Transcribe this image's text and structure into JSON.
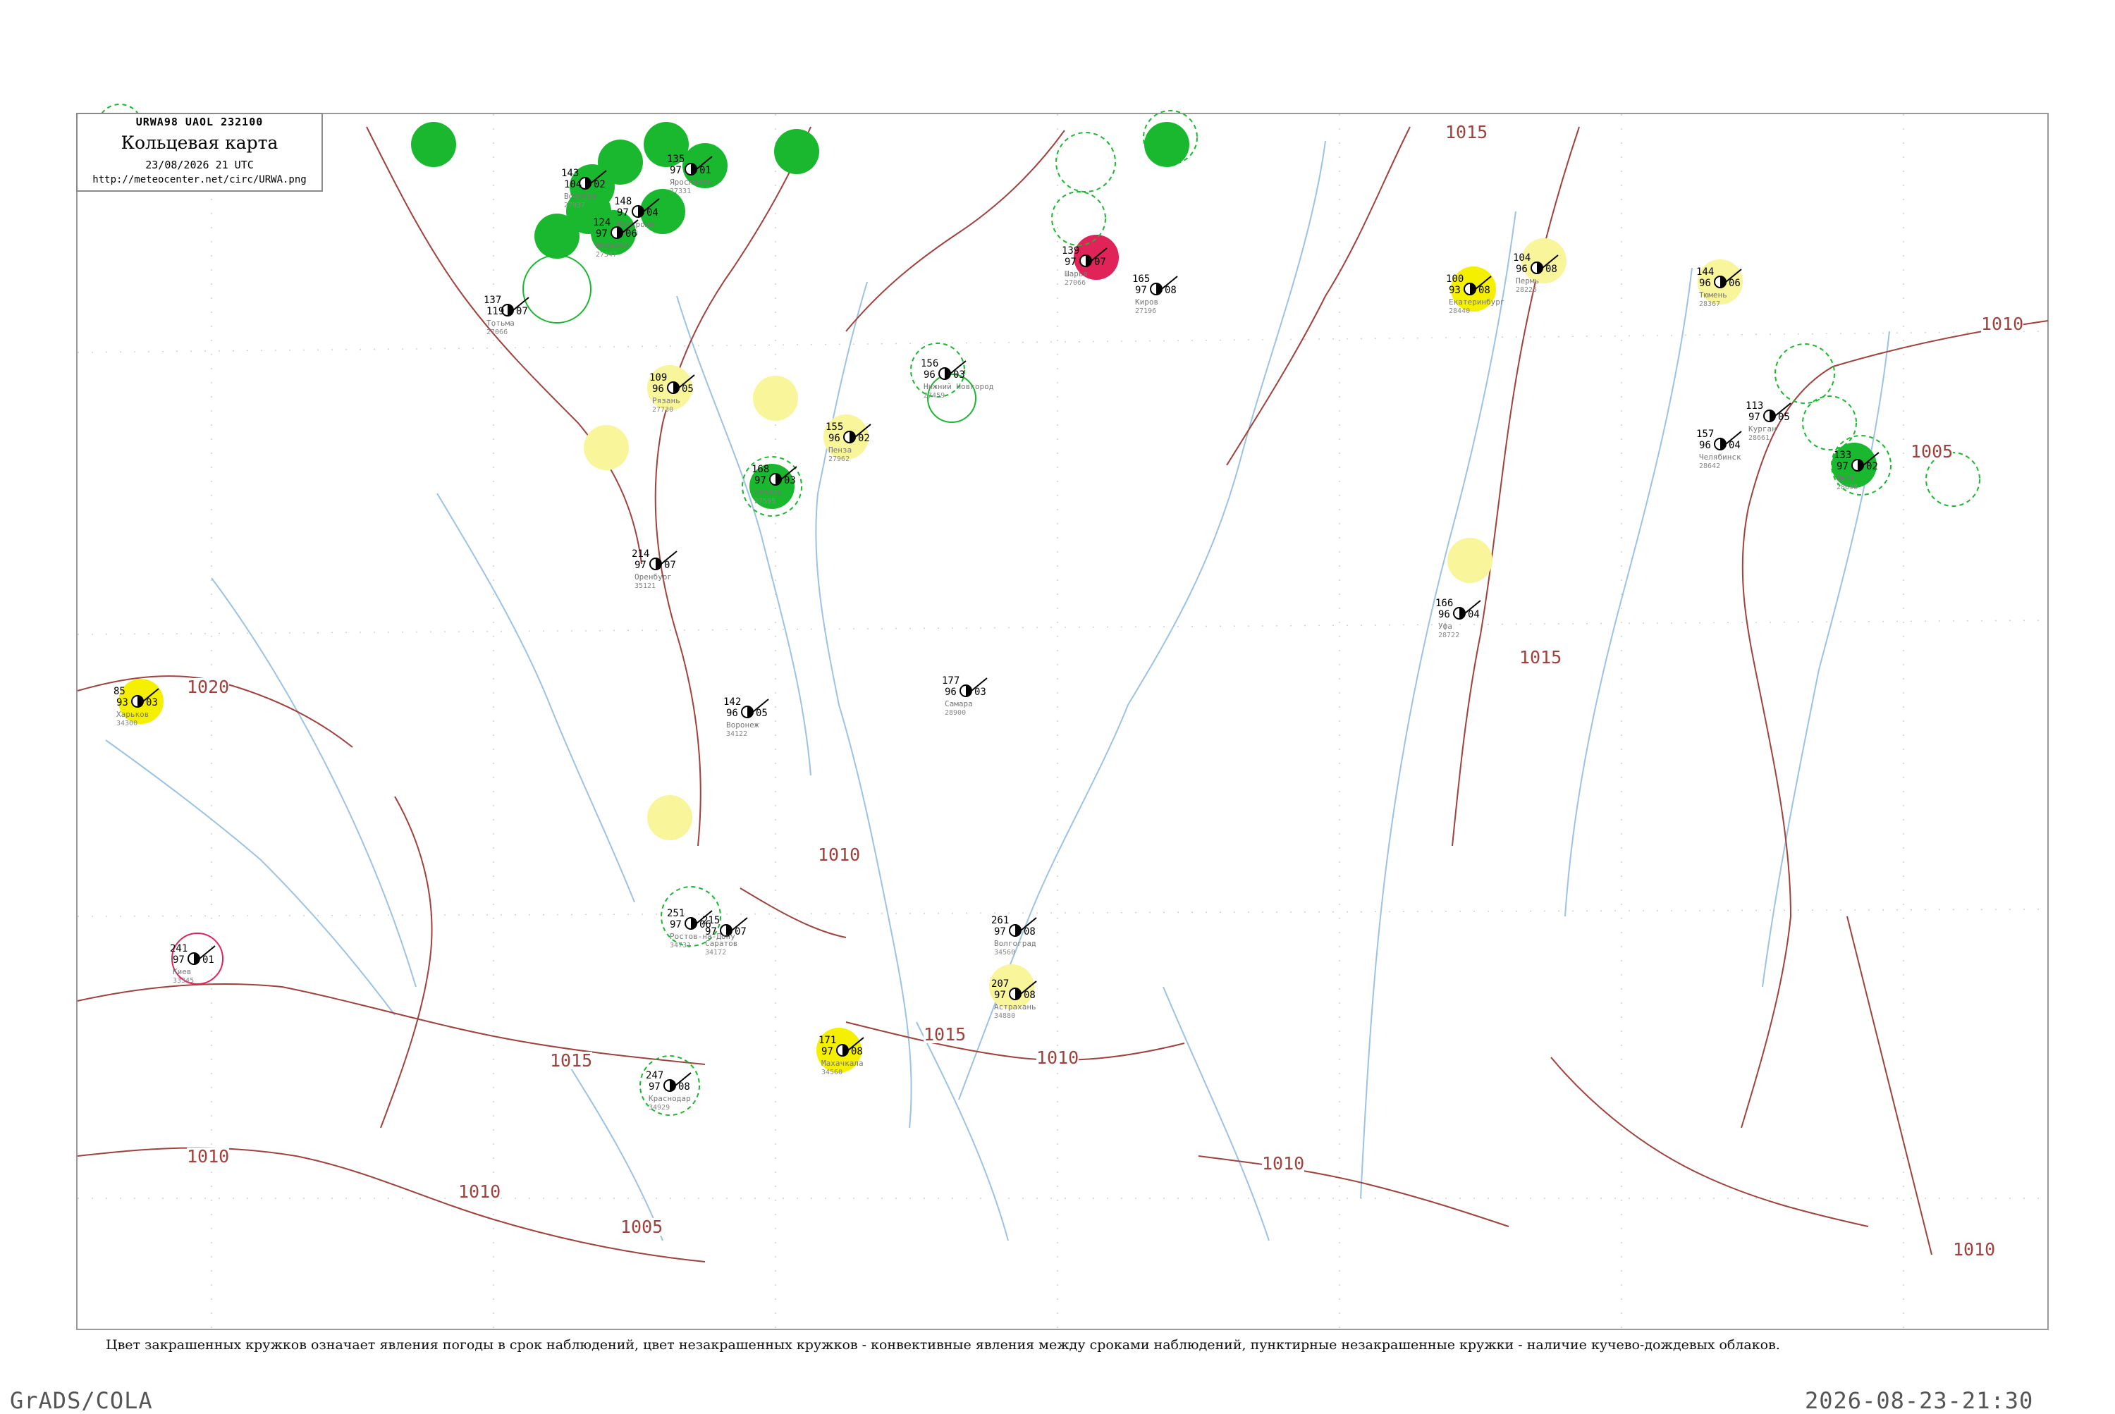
{
  "header": {
    "product_code": "URWA98  UAOL  232100",
    "title": "Кольцевая карта",
    "datetime": "23/08/2026 21 UTC",
    "url": "http://meteocenter.net/circ/URWA.png"
  },
  "caption": "Цвет закрашенных кружков означает явления погоды в срок наблюдений, цвет незакрашенных кружков - конвективные явления между сроками наблюдений, пунктирные незакрашенные кружки - наличие кучево-дождевых облаков.",
  "footer": {
    "software": "GrADS/COLA",
    "timestamp": "2026-08-23-21:30"
  },
  "colors": {
    "isobar": "#a0413c",
    "river": "#9cc2e6",
    "gridline": "#bfbfbf",
    "station": "#000000",
    "thunderstorm": "#19b82e",
    "precip_yellow": "#f5f000",
    "precip_light": "#f8f59a",
    "fog_red": "#e0245a",
    "cb_dashed": "#19b82e"
  },
  "isobars": [
    {
      "label": "1010",
      "value": 1010
    },
    {
      "label": "1015",
      "value": 1015
    },
    {
      "label": "1020",
      "value": 1020
    },
    {
      "label": "1005",
      "value": 1005
    }
  ],
  "iso_labels": [
    {
      "label": "1015",
      "pos": "top-center"
    },
    {
      "label": "1010",
      "pos": "right-upper"
    },
    {
      "label": "1005",
      "pos": "right-middle"
    },
    {
      "label": "1020",
      "pos": "left-middle"
    },
    {
      "label": "1010",
      "pos": "center"
    },
    {
      "label": "1015",
      "pos": "right-center"
    },
    {
      "label": "1015",
      "pos": "center-south"
    },
    {
      "label": "1010",
      "pos": "center-south"
    },
    {
      "label": "1015",
      "pos": "left-south"
    },
    {
      "label": "1010",
      "pos": "left-south"
    },
    {
      "label": "1010",
      "pos": "south"
    },
    {
      "label": "1005",
      "pos": "south"
    },
    {
      "label": "1010",
      "pos": "south-right"
    },
    {
      "label": "1010",
      "pos": "far-right-south"
    }
  ],
  "stations": [
    {
      "name": "Тотьма",
      "id": "27066",
      "t": "137",
      "p": "119",
      "dp": "07",
      "color": "none"
    },
    {
      "name": "Вологда",
      "id": "27037",
      "t": "143",
      "p": "104",
      "dp": "02",
      "color": "none"
    },
    {
      "name": "Кострома",
      "id": "27333",
      "t": "148",
      "p": "97",
      "dp": "04",
      "color": "thunderstorm"
    },
    {
      "name": "Иваново",
      "id": "27347",
      "t": "124",
      "p": "97",
      "dp": "06",
      "color": "thunderstorm"
    },
    {
      "name": "Ярославль",
      "id": "27331",
      "t": "135",
      "p": "97",
      "dp": "01",
      "color": "thunderstorm"
    },
    {
      "name": "Шарья",
      "id": "27066",
      "t": "139",
      "p": "97",
      "dp": "07",
      "color": "fog"
    },
    {
      "name": "Киров",
      "id": "27196",
      "t": "165",
      "p": "97",
      "dp": "08",
      "color": "none"
    },
    {
      "name": "Пермь",
      "id": "28225",
      "t": "104",
      "p": "96",
      "dp": "08",
      "color": "precip_light"
    },
    {
      "name": "Екатеринбург",
      "id": "28440",
      "t": "100",
      "p": "93",
      "dp": "08",
      "color": "precip_yellow"
    },
    {
      "name": "Тюмень",
      "id": "28367",
      "t": "144",
      "p": "96",
      "dp": "06",
      "color": "precip_light"
    },
    {
      "name": "Рязань",
      "id": "27730",
      "t": "109",
      "p": "96",
      "dp": "05",
      "color": "precip_light"
    },
    {
      "name": "Пенза",
      "id": "27962",
      "t": "155",
      "p": "96",
      "dp": "02",
      "color": "precip_light"
    },
    {
      "name": "Нижний Новгород",
      "id": "27459",
      "t": "156",
      "p": "96",
      "dp": "03",
      "color": "none"
    },
    {
      "name": "Казань",
      "id": "27595",
      "t": "168",
      "p": "97",
      "dp": "03",
      "color": "none"
    },
    {
      "name": "Самара",
      "id": "28900",
      "t": "177",
      "p": "96",
      "dp": "03",
      "color": "none"
    },
    {
      "name": "Оренбург",
      "id": "35121",
      "t": "214",
      "p": "97",
      "dp": "07",
      "color": "none"
    },
    {
      "name": "Уфа",
      "id": "28722",
      "t": "166",
      "p": "96",
      "dp": "04",
      "color": "none"
    },
    {
      "name": "Челябинск",
      "id": "28642",
      "t": "157",
      "p": "96",
      "dp": "04",
      "color": "none"
    },
    {
      "name": "Курган",
      "id": "28661",
      "t": "113",
      "p": "97",
      "dp": "05",
      "color": "none"
    },
    {
      "name": "Омск",
      "id": "28698",
      "t": "133",
      "p": "97",
      "dp": "02",
      "color": "thunderstorm"
    },
    {
      "name": "Волгоград",
      "id": "34560",
      "t": "261",
      "p": "97",
      "dp": "08",
      "color": "none"
    },
    {
      "name": "Астрахань",
      "id": "34880",
      "t": "207",
      "p": "97",
      "dp": "08",
      "color": "precip_light"
    },
    {
      "name": "Саратов",
      "id": "34172",
      "t": "215",
      "p": "97",
      "dp": "07",
      "color": "none"
    },
    {
      "name": "Воронеж",
      "id": "34122",
      "t": "142",
      "p": "96",
      "dp": "05",
      "color": "none"
    },
    {
      "name": "Ростов-на-Дону",
      "id": "34731",
      "t": "251",
      "p": "97",
      "dp": "06",
      "color": "cb"
    },
    {
      "name": "Краснодар",
      "id": "34929",
      "t": "247",
      "p": "97",
      "dp": "08",
      "color": "cb"
    },
    {
      "name": "Махачкала",
      "id": "34560",
      "t": "171",
      "p": "97",
      "dp": "08",
      "color": "precip_yellow"
    },
    {
      "name": "Харьков",
      "id": "34300",
      "t": "85",
      "p": "93",
      "dp": "03",
      "color": "precip_yellow"
    },
    {
      "name": "Киев",
      "id": "33345",
      "t": "241",
      "p": "97",
      "dp": "01",
      "color": "fog"
    }
  ]
}
